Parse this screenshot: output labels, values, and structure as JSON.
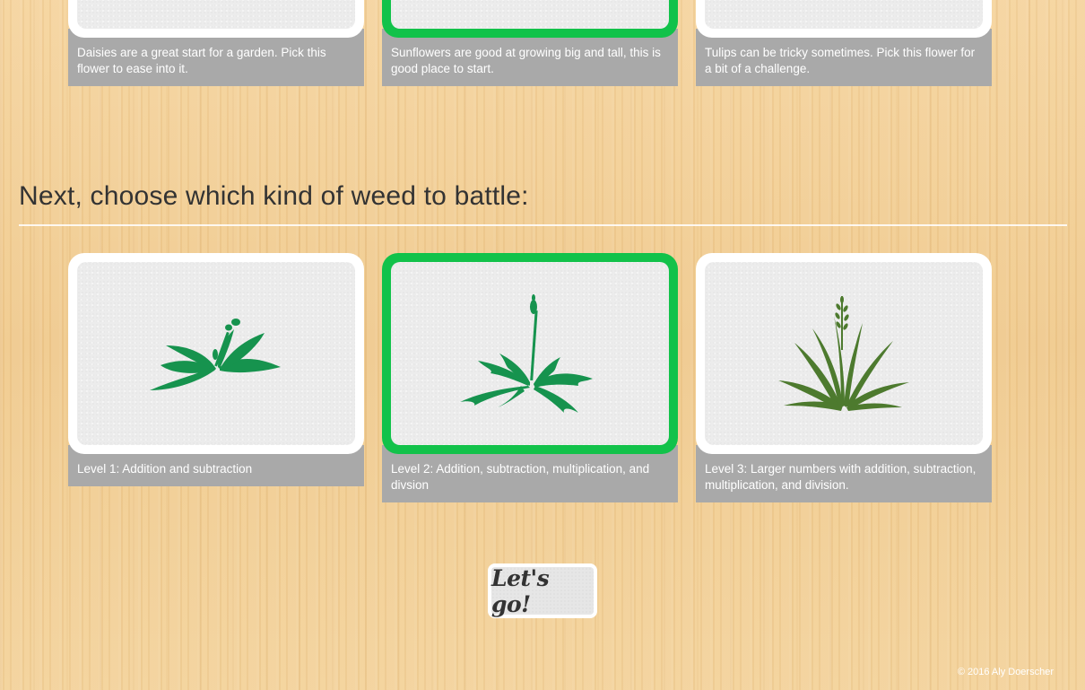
{
  "flowers": {
    "cards": [
      {
        "caption": "Daisies are a great start for a garden. Pick this flower to ease into it.",
        "selected": false
      },
      {
        "caption": "Sunflowers are good at growing big and tall, this is good place to start.",
        "selected": true
      },
      {
        "caption": "Tulips can be tricky sometimes. Pick this flower for a bit of a challenge.",
        "selected": false
      }
    ]
  },
  "weeds": {
    "heading": "Next, choose which kind of weed to battle:",
    "cards": [
      {
        "caption": "Level 1: Addition and subtraction",
        "icon": "plantain-weed-icon",
        "selected": false
      },
      {
        "caption": "Level 2: Addition, subtraction, multiplication, and divsion",
        "icon": "dandelion-weed-icon",
        "selected": true
      },
      {
        "caption": "Level 3: Larger numbers with addition, subtraction, multiplication, and division.",
        "icon": "grass-weed-icon",
        "selected": false
      }
    ]
  },
  "actions": {
    "go_label": "Let's go!"
  },
  "footer": {
    "copyright": "© 2016 Aly Doerscher"
  },
  "colors": {
    "selected_border": "#12c24a",
    "caption_bg": "#a9a9a9",
    "weed_green": "#16934e",
    "grass_green": "#4d7a2e"
  }
}
